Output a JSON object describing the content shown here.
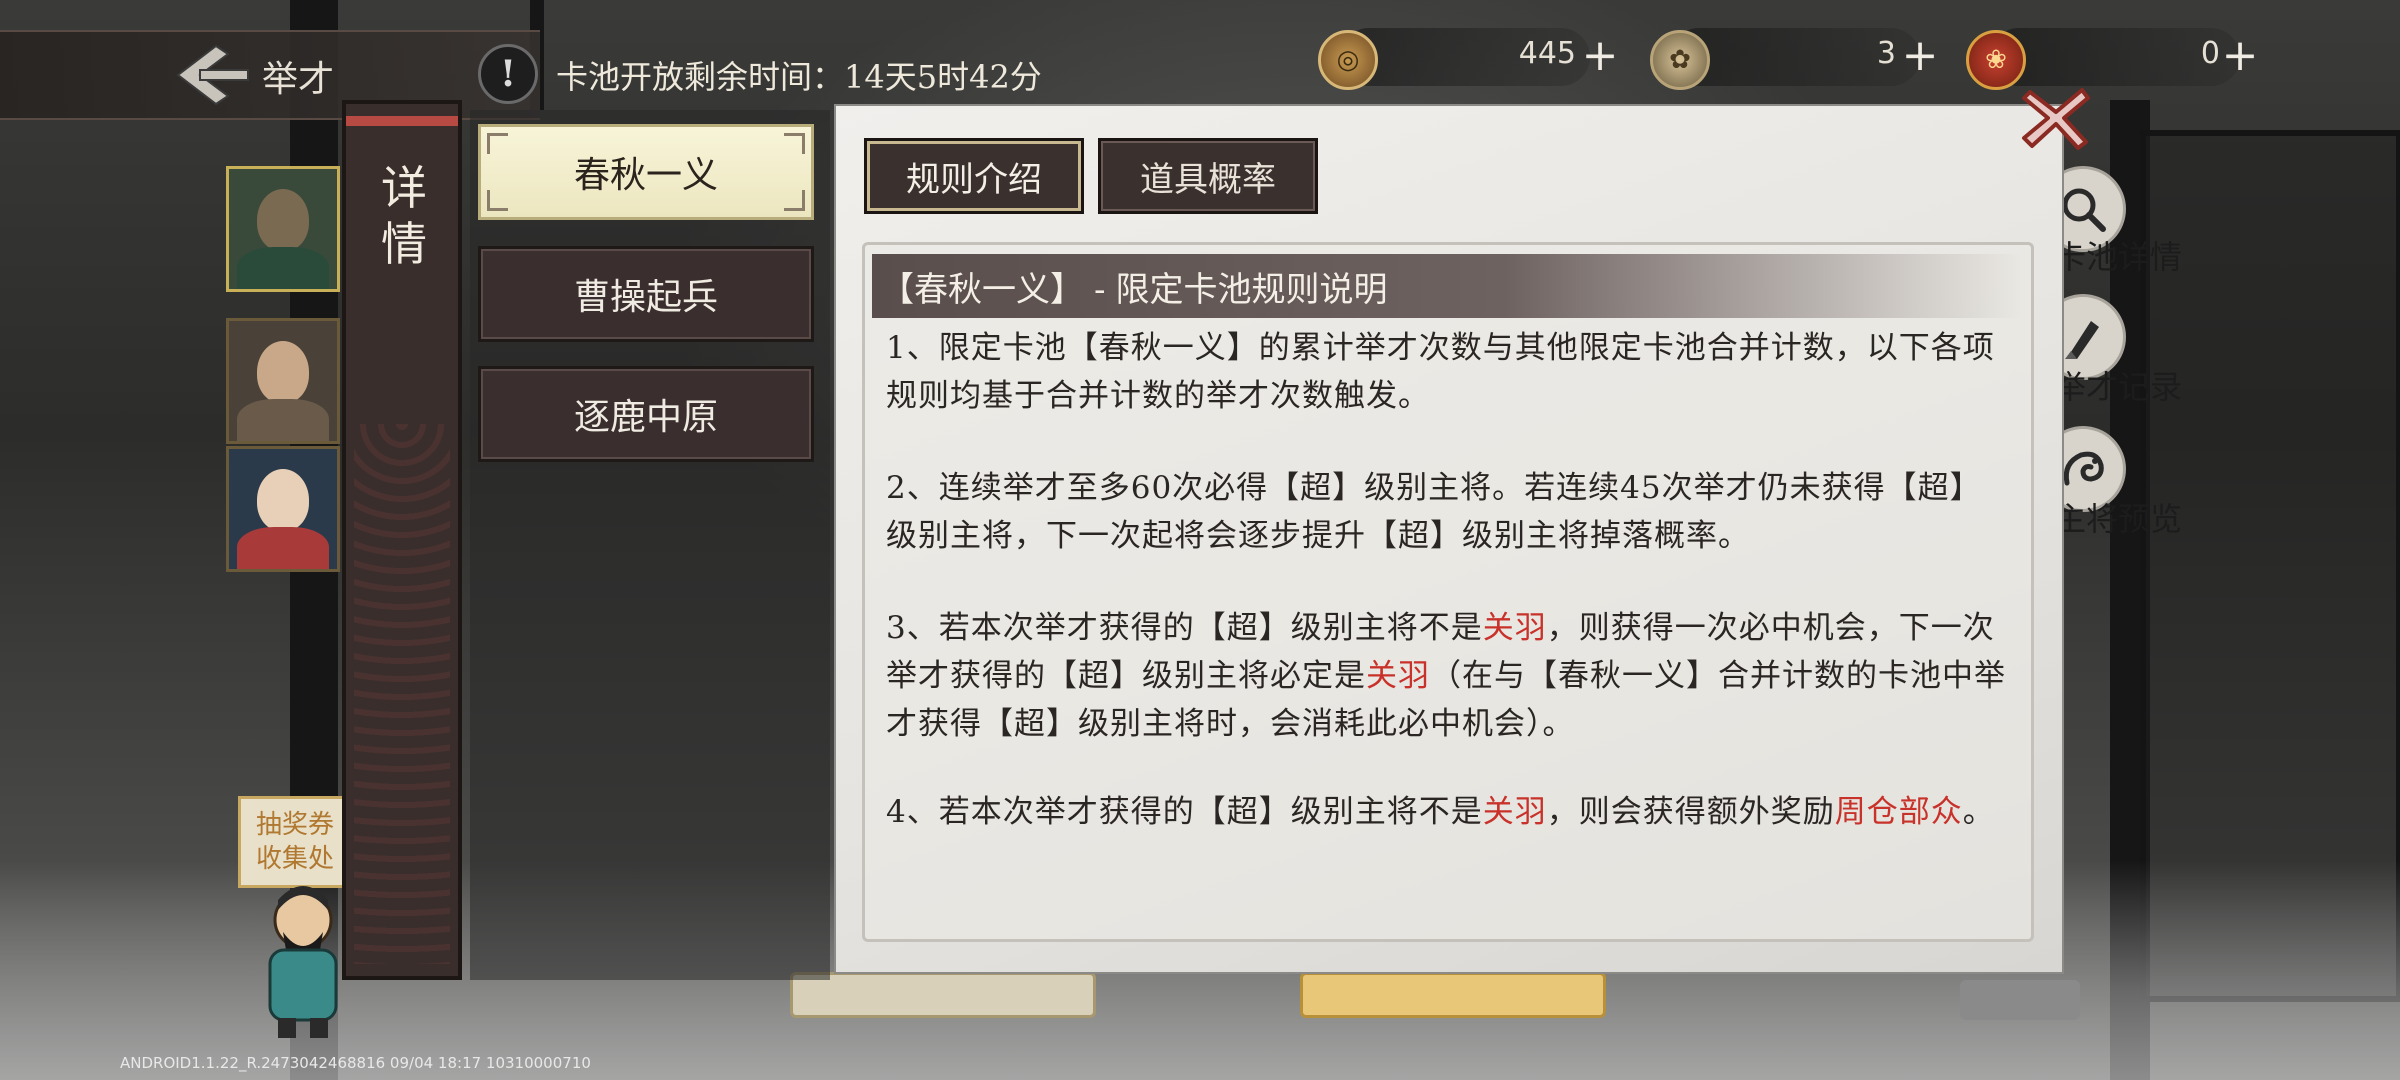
{
  "header": {
    "back_label": "举才",
    "timer_icon": "!",
    "timer_text": "卡池开放剩余时间：14天5时42分"
  },
  "resources": [
    {
      "name": "coin",
      "icon": "coin-icon",
      "value": "445",
      "plus": "+"
    },
    {
      "name": "token",
      "icon": "token-icon",
      "value": "3",
      "plus": "+"
    },
    {
      "name": "seal",
      "icon": "seal-icon",
      "value": "0",
      "plus": "+"
    }
  ],
  "sidebar": {
    "title_line1": "详",
    "title_line2": "情"
  },
  "pool_tabs": [
    {
      "label": "春秋一义",
      "active": true
    },
    {
      "label": "曹操起兵",
      "active": false
    },
    {
      "label": "逐鹿中原",
      "active": false
    }
  ],
  "rule_tabs": [
    {
      "label": "规则介绍",
      "active": true
    },
    {
      "label": "道具概率",
      "active": false
    }
  ],
  "content": {
    "header_bracketed": "【春秋一义】",
    "header_dash": "-",
    "header_rest": "限定卡池规则说明",
    "p1": "1、限定卡池【春秋一义】的累计举才次数与其他限定卡池合并计数，以下各项规则均基于合并计数的举才次数触发。",
    "p2": "2、连续举才至多60次必得【超】级别主将。若连续45次举才仍未获得【超】级别主将，下一次起将会逐步提升【超】级别主将掉落概率。",
    "p3_a": "3、若本次举才获得的【超】级别主将不是",
    "p3_hl1": "关羽",
    "p3_b": "，则获得一次必中机会，下一次举才获得的【超】级别主将必定是",
    "p3_hl2": "关羽",
    "p3_c": "（在与【春秋一义】合并计数的卡池中举才获得【超】级别主将时，会消耗此必中机会）。",
    "p4_a": "4、若本次举才获得的【超】级别主将不是",
    "p4_hl1": "关羽",
    "p4_b": "，则会获得额外奖励",
    "p4_hl2": "周仓部众",
    "p4_c": "。"
  },
  "right_menu": [
    {
      "label": "卡池详情",
      "icon": "magnifier-icon"
    },
    {
      "label": "举才记录",
      "icon": "brush-icon"
    },
    {
      "label": "主将预览",
      "icon": "dragon-icon"
    }
  ],
  "ticket": {
    "line1": "抽奖券",
    "line2": "收集处"
  },
  "footer": "ANDROID1.1.22_R.2473042468816 09/04 18:17 10310000710",
  "colors": {
    "highlight": "#c8322a",
    "active_tab": "#f6f2d4",
    "panel_bg": "#ecebe8"
  }
}
